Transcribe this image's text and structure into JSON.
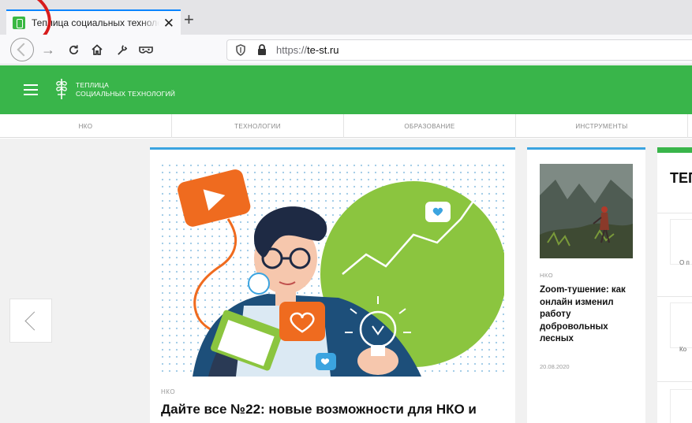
{
  "browser": {
    "tab_title": "Теплица социальных технологий",
    "tab_close": "✕",
    "new_tab": "+",
    "url_protocol": "https://",
    "url_host": "te-st.ru"
  },
  "site": {
    "logo_line1": "ТЕПЛИЦА",
    "logo_line2": "СОЦИАЛЬНЫХ ТЕХНОЛОГИЙ",
    "categories": [
      "НКО",
      "ТЕХНОЛОГИИ",
      "ОБРАЗОВАНИЕ",
      "ИНСТРУМЕНТЫ"
    ],
    "accent_color": "#39b54a",
    "card_top_color": "#3ba4e0"
  },
  "main_article": {
    "rubric": "НКО",
    "headline": "Дайте все №22: новые возможности для НКО и"
  },
  "side_article": {
    "rubric": "НКО",
    "headline": "Zoom-тушение: как онлайн изменил работу добровольных лесных",
    "date": "20.08.2020"
  },
  "right_panel": {
    "heading": "ТЕП",
    "item1": "О п",
    "item2": "Ко"
  }
}
